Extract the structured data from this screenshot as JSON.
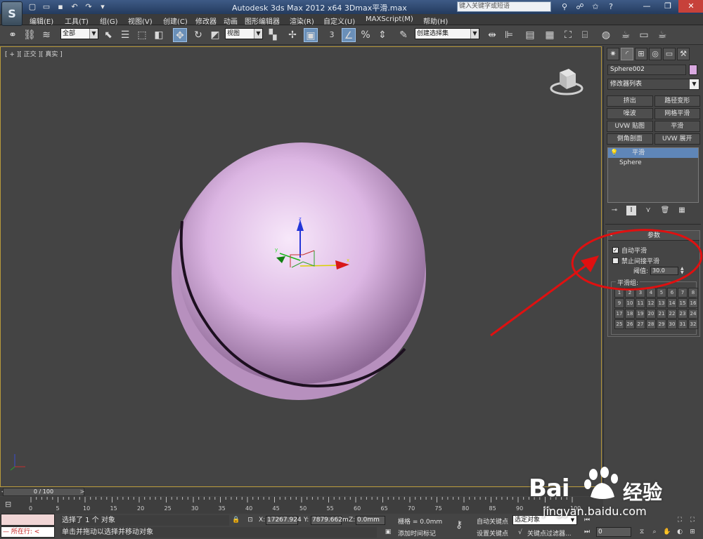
{
  "titlebar": {
    "logo": "S",
    "title": "Autodesk 3ds Max  2012 x64     3Dmax平滑.max",
    "search_placeholder": "键入关键字或短语",
    "quick_access": [
      "new-icon",
      "open-icon",
      "save-icon",
      "undo-icon",
      "redo-icon",
      "dropdown-icon"
    ]
  },
  "menu": [
    "编辑(E)",
    "工具(T)",
    "组(G)",
    "视图(V)",
    "创建(C)",
    "修改器",
    "动画",
    "图形编辑器",
    "渲染(R)",
    "自定义(U)",
    "MAXScript(M)",
    "帮助(H)"
  ],
  "toolbar": {
    "filter_value": "全部",
    "refcoord_value": "视图",
    "named_selection_value": "创建选择集",
    "snap_label": "3"
  },
  "viewport": {
    "label": "[ + ][ 正交 ][ 真实 ]",
    "gizmo_labels": {
      "x": "x",
      "y": "y",
      "z": "z"
    },
    "object_color": "#d9a9e0"
  },
  "panel": {
    "object_name": "Sphere002",
    "object_color": "#d9a9e0",
    "modifier_list": "修改器列表",
    "modifier_buttons": [
      "挤出",
      "路径变形",
      "噪波",
      "网格平滑",
      "UVW 贴图",
      "平滑",
      "倒角剖面",
      "UVW 展开"
    ],
    "stack": {
      "selected": "平滑",
      "base": "Sphere"
    },
    "rollout_title": "参数",
    "auto_smooth_label": "自动平滑",
    "auto_smooth_checked": true,
    "prevent_indirect_label": "禁止间接平滑",
    "prevent_indirect_checked": false,
    "threshold_label": "阈值:",
    "threshold_value": "30.0",
    "smooth_group_title": "平滑组:",
    "smooth_groups": [
      "1",
      "2",
      "3",
      "4",
      "5",
      "6",
      "7",
      "8",
      "9",
      "10",
      "11",
      "12",
      "13",
      "14",
      "15",
      "16",
      "17",
      "18",
      "19",
      "20",
      "21",
      "22",
      "23",
      "24",
      "25",
      "26",
      "27",
      "28",
      "29",
      "30",
      "31",
      "32"
    ]
  },
  "timeline": {
    "slider_label": "0 / 100",
    "ticks": [
      "0",
      "5",
      "10",
      "15",
      "20",
      "25",
      "30",
      "35",
      "40",
      "45",
      "50",
      "55",
      "60",
      "65",
      "70",
      "75",
      "80",
      "85",
      "90",
      "95",
      "100"
    ]
  },
  "status": {
    "running_label": "所在行:",
    "selection_text": "选择了 1 个 对象",
    "prompt_text": "单击并拖动以选择并移动对象",
    "x_label": "X:",
    "x_value": "17267.924",
    "y_label": "Y:",
    "y_value": "7879.662m",
    "z_label": "Z:",
    "z_value": "0.0mm",
    "grid_text": "栅格 = 0.0mm",
    "add_time_tag": "添加时间标记",
    "auto_key": "自动关键点",
    "set_key": "设置关键点",
    "selection_set": "选定对象",
    "key_filters": "关键点过滤器...",
    "current_frame": "0"
  },
  "watermark": {
    "logo": "Bai",
    "logo_tail": "经验",
    "url": "jingyan.baidu.com"
  }
}
